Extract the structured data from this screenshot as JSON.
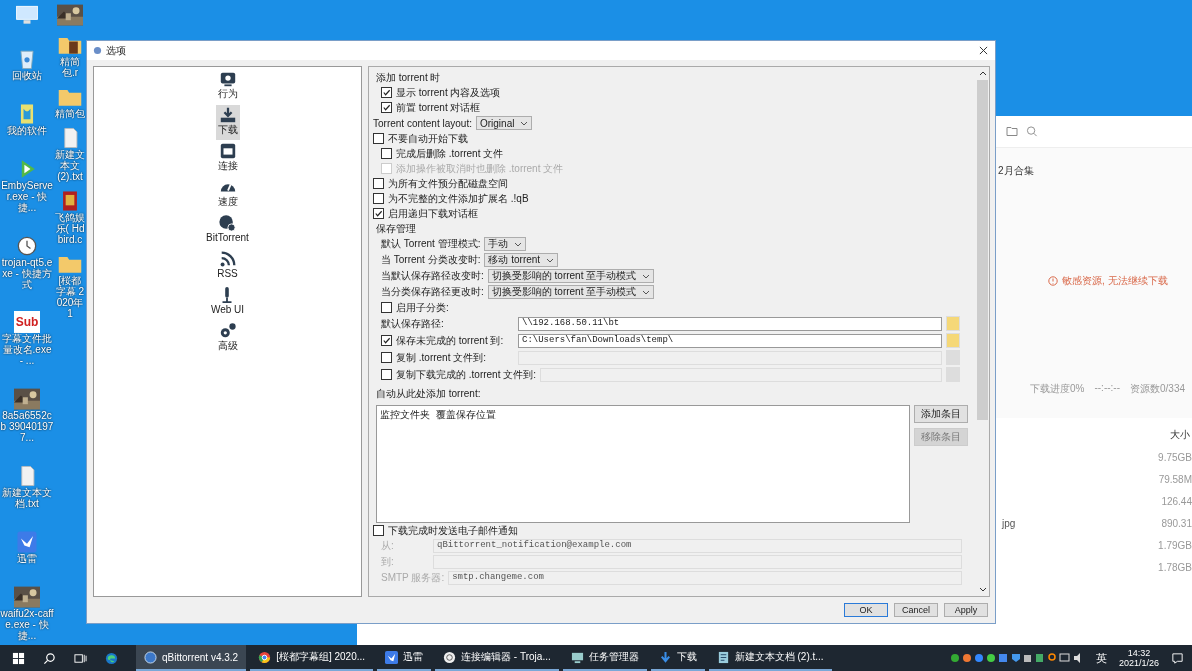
{
  "desktop": {
    "columns": [
      [
        {
          "kind": "computer"
        },
        {
          "kind": "recycle",
          "label": "回收站"
        },
        {
          "kind": "app",
          "label": "我的软件"
        },
        {
          "kind": "play",
          "label": "EmbyServer.exe - 快捷..."
        },
        {
          "kind": "clock",
          "label": "trojan-qt5.exe - 快捷方式"
        },
        {
          "kind": "sub",
          "icon_text": "Sub",
          "label": "字幕文件批量改名.exe - ..."
        },
        {
          "kind": "picture",
          "label": "8a5a6552cb 390401977..."
        },
        {
          "kind": "file",
          "label": "新建文本文档.txt"
        },
        {
          "kind": "bird",
          "label": "迅雷"
        },
        {
          "kind": "picture",
          "label": "waifu2x-caff e.exe - 快捷..."
        }
      ],
      [
        {
          "kind": "picture"
        },
        {
          "kind": "archive",
          "label": "精简包.r"
        },
        {
          "kind": "folder",
          "label": "精简包"
        },
        {
          "kind": "file",
          "label": "新建文本文 (2).txt"
        },
        {
          "kind": "book",
          "label": "飞鸽娱乐( Hdbird.c"
        },
        {
          "kind": "folder",
          "label": "[桜都字幕 2020年1"
        }
      ]
    ]
  },
  "background_window": {
    "folder_title": "2月合集",
    "warning": "敏感资源, 无法继续下载",
    "progress": "下载进度0%",
    "time": "--:--:--",
    "sources": "资源数0/334",
    "size_header": "大小",
    "rows": [
      {
        "size": "9.75GB"
      },
      {
        "size": "79.58M"
      },
      {
        "size": "126.44"
      },
      {
        "name": "jpg",
        "size": "890.31"
      },
      {
        "size": "1.79GB"
      },
      {
        "size": "1.78GB"
      }
    ]
  },
  "dialog": {
    "title": "选项",
    "sidebar": [
      {
        "kind": "behavior",
        "label": "行为",
        "selected": false
      },
      {
        "kind": "download",
        "label": "下载",
        "selected": true
      },
      {
        "kind": "connection",
        "label": "连接",
        "selected": false
      },
      {
        "kind": "speed",
        "label": "速度",
        "selected": false
      },
      {
        "kind": "bittorrent",
        "label": "BitTorrent",
        "selected": false
      },
      {
        "kind": "rss",
        "label": "RSS",
        "selected": false
      },
      {
        "kind": "webui",
        "label": "Web UI",
        "selected": false
      },
      {
        "kind": "advanced",
        "label": "高级",
        "selected": false
      }
    ],
    "options": [
      {
        "kind": "heading",
        "text": "添加 torrent 时",
        "children": [
          {
            "kind": "check",
            "text": "显示 torrent 内容及选项",
            "checked": true
          },
          {
            "kind": "check",
            "text": "前置 torrent 对话框",
            "checked": true
          }
        ]
      },
      {
        "kind": "combo",
        "label": "Torrent content layout:",
        "value": "Original"
      },
      {
        "kind": "check",
        "text": "不要自动开始下载",
        "checked": false,
        "children": [
          {
            "kind": "check",
            "text": "完成后删除 .torrent 文件",
            "checked": false
          },
          {
            "kind": "check",
            "text": "添加操作被取消时也删除 .torrent 文件",
            "checked": false,
            "disabled": true
          }
        ]
      },
      {
        "kind": "check",
        "text": "为所有文件预分配磁盘空间",
        "checked": false
      },
      {
        "kind": "check",
        "text": "为不完整的文件添加扩展名 .!qB",
        "checked": false
      },
      {
        "kind": "check",
        "text": "启用递归下载对话框",
        "checked": true
      },
      {
        "kind": "heading",
        "text": "保存管理",
        "children": [
          {
            "kind": "combo",
            "label": "默认 Torrent 管理模式:",
            "value": "手动"
          },
          {
            "kind": "combo",
            "label": "当 Torrent 分类改变时:",
            "value": "移动 torrent"
          },
          {
            "kind": "combo",
            "label": "当默认保存路径改变时:",
            "value": "切换受影响的 torrent 至手动模式"
          },
          {
            "kind": "combo",
            "label": "当分类保存路径更改时:",
            "value": "切换受影响的 torrent 至手动模式"
          },
          {
            "kind": "check",
            "text": "启用子分类:",
            "checked": false
          },
          {
            "kind": "path",
            "label": "默认保存路径:",
            "value": "\\\\192.168.50.11\\bt"
          },
          {
            "kind": "check-path",
            "label": "保存未完成的 torrent 到:",
            "checked": true,
            "value": "C:\\Users\\fan\\Downloads\\temp\\"
          },
          {
            "kind": "check-path",
            "label": "复制 .torrent 文件到:",
            "checked": false
          },
          {
            "kind": "check-path",
            "label": "复制下载完成的 .torrent 文件到:",
            "checked": false
          }
        ]
      },
      {
        "kind": "watch",
        "label": "自动从此处添加 torrent:",
        "columns": [
          "监控文件夹",
          "覆盖保存位置"
        ],
        "buttons": [
          {
            "label": "添加条目",
            "disabled": false
          },
          {
            "label": "移除条目",
            "disabled": true
          }
        ]
      },
      {
        "kind": "check",
        "text": "下载完成时发送电子邮件通知",
        "checked": false,
        "children": [
          {
            "kind": "field",
            "label": "从:",
            "value": "qBittorrent_notification@example.com",
            "disabled": true
          },
          {
            "kind": "field",
            "label": "到:",
            "disabled": true
          },
          {
            "kind": "field",
            "label": "SMTP 服务器:",
            "value": "smtp.changeme.com",
            "disabled": true
          }
        ]
      }
    ],
    "buttons": [
      {
        "label": "OK",
        "default": true
      },
      {
        "label": "Cancel",
        "default": false
      },
      {
        "label": "Apply",
        "default": false
      }
    ]
  },
  "taskbar": {
    "pinned": [
      {
        "kind": "start"
      },
      {
        "kind": "search"
      },
      {
        "kind": "taskview"
      },
      {
        "kind": "browser"
      }
    ],
    "apps": [
      {
        "kind": "disc",
        "label": "qBittorrent v4.3.2",
        "selected": true
      },
      {
        "kind": "ring",
        "label": "[桜都字幕组] 2020...",
        "selected": false
      },
      {
        "kind": "bird",
        "label": "迅雷",
        "selected": false
      },
      {
        "kind": "gear",
        "label": "连接编辑器 - Troja...",
        "selected": false
      },
      {
        "kind": "monitor",
        "label": "任务管理器",
        "selected": false
      },
      {
        "kind": "arrow",
        "label": "下载",
        "selected": false
      },
      {
        "kind": "notepad",
        "label": "新建文本文档 (2).t...",
        "selected": false
      }
    ],
    "ime": "英",
    "time": "14:32",
    "date": "2021/1/26"
  }
}
